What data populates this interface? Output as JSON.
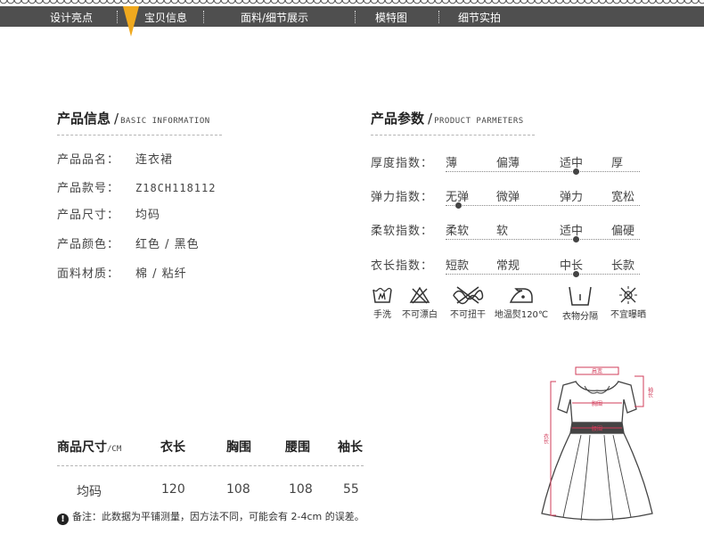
{
  "nav": {
    "items": [
      "设计亮点",
      "宝贝信息",
      "面料/细节展示",
      "模特图",
      "细节实拍"
    ]
  },
  "basic": {
    "title": "产品信息",
    "subtitle": "BASIC INFORMATION",
    "rows": [
      {
        "label": "产品品名：",
        "value": "连衣裙"
      },
      {
        "label": "产品款号：",
        "value": "Z18CH118112"
      },
      {
        "label": "产品尺寸：",
        "value": "均码"
      },
      {
        "label": "产品颜色：",
        "value": "红色 / 黑色"
      },
      {
        "label": "面料材质：",
        "value": "棉 / 粘纤"
      }
    ]
  },
  "params": {
    "title": "产品参数",
    "subtitle": "PRODUCT PARMETERS",
    "rows": [
      {
        "label": "厚度指数：",
        "options": [
          "薄",
          "偏薄",
          "适中",
          "厚"
        ],
        "selected": 2
      },
      {
        "label": "弹力指数：",
        "options": [
          "无弹",
          "微弹",
          "弹力",
          "宽松"
        ],
        "selected": 0
      },
      {
        "label": "柔软指数：",
        "options": [
          "柔软",
          "软",
          "适中",
          "偏硬"
        ],
        "selected": 2
      },
      {
        "label": "衣长指数：",
        "options": [
          "短款",
          "常规",
          "中长",
          "长款"
        ],
        "selected": 2
      }
    ]
  },
  "care": {
    "items": [
      {
        "icon": "hand-wash-icon",
        "label": "手洗"
      },
      {
        "icon": "no-bleach-icon",
        "label": "不可漂白"
      },
      {
        "icon": "no-wring-icon",
        "label": "不可扭干"
      },
      {
        "icon": "low-iron-icon",
        "label": "地温熨120℃"
      },
      {
        "icon": "separate-wash-icon",
        "label": "衣物分隔"
      },
      {
        "icon": "no-sun-icon",
        "label": "不宜曝晒"
      }
    ]
  },
  "size_table": {
    "header_label": "商品尺寸",
    "unit": "/CM",
    "columns": [
      "衣长",
      "胸围",
      "腰围",
      "袖长"
    ],
    "row": {
      "size": "均码",
      "values": [
        "120",
        "108",
        "108",
        "55"
      ]
    }
  },
  "note": {
    "text": "备注：此数据为平铺测量，因方法不同，可能会有 2-4cm 的误差。"
  },
  "diagram": {
    "labels": {
      "shoulder": "肩宽",
      "sleeve": "袖长",
      "bust": "胸围",
      "waist": "腰围",
      "length": "衣长"
    }
  },
  "colors": {
    "nav_bg": "#4f4f4f",
    "accent": "#f0a91e",
    "measure": "#d23c5a"
  }
}
